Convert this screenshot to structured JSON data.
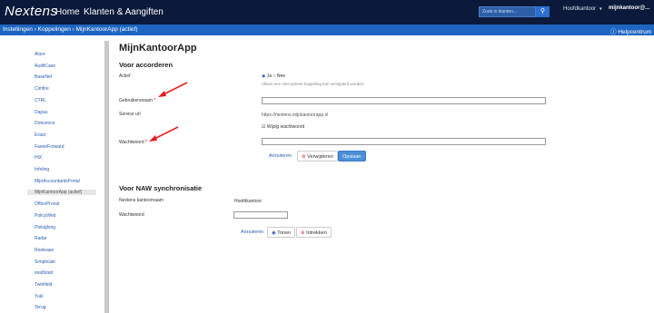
{
  "header": {
    "logo": "Nextens",
    "nav": [
      "Home",
      "Klanten & Aangiften"
    ],
    "search_placeholder": "Zoek in klanten...",
    "office": "Hoofdkantoor",
    "user": "mijnkantoor@..."
  },
  "breadcrumb": {
    "text": "Instellingen › Koppelingen › MijnKantoorApp (actief)",
    "help": "Helpcentrum"
  },
  "sidebar": {
    "items": [
      "Alure",
      "AuditCase",
      "BaseNet",
      "Cimfire",
      "CTRL",
      "Dapas",
      "Dotcomce",
      "Exact",
      "FasterForward",
      "HiX",
      "Infoling",
      "MijnAccountantsPortal",
      "MijnKantoorApp (actief)",
      "OfficeProval",
      "PolicyWeb",
      "Plekighing",
      "Radar",
      "Reelease",
      "Simplicate",
      "sna8start",
      "Twinfield",
      "Yuki",
      "Terug"
    ],
    "active_index": 12
  },
  "page": {
    "title": "MijnKantoorApp",
    "section1": "Voor accorderen",
    "actief_label": "Actief",
    "ja": "Ja",
    "nee": "Nee",
    "actief_hint": "Alleen een niet-actieve koppeling kan verwijderd worden.",
    "username_label": "Gebruikersnaam",
    "service_label": "Service url",
    "service_url": "https://nextens.mijnkantoorapp.nl",
    "wijzig_label": "Wijzig wachtwoord",
    "password_label": "Wachtwoord",
    "annuleren": "Annuleren",
    "verwijderen": "Verwijderen",
    "opslaan": "Opslaan",
    "section2": "Voor NAW synchronisatie",
    "kantoor_label": "Nextens kantoornaam",
    "kantoor_value": "Hoofdkantoor",
    "password2_label": "Wachtwoord",
    "annuleren2": "Annuleren",
    "tonen": "Tonen",
    "intrekken": "Intrekken"
  },
  "colors": {
    "topbar": "#0b1a3a",
    "crumbbar": "#1d65c1",
    "primary": "#4a8fd8",
    "danger": "#d9413b"
  }
}
